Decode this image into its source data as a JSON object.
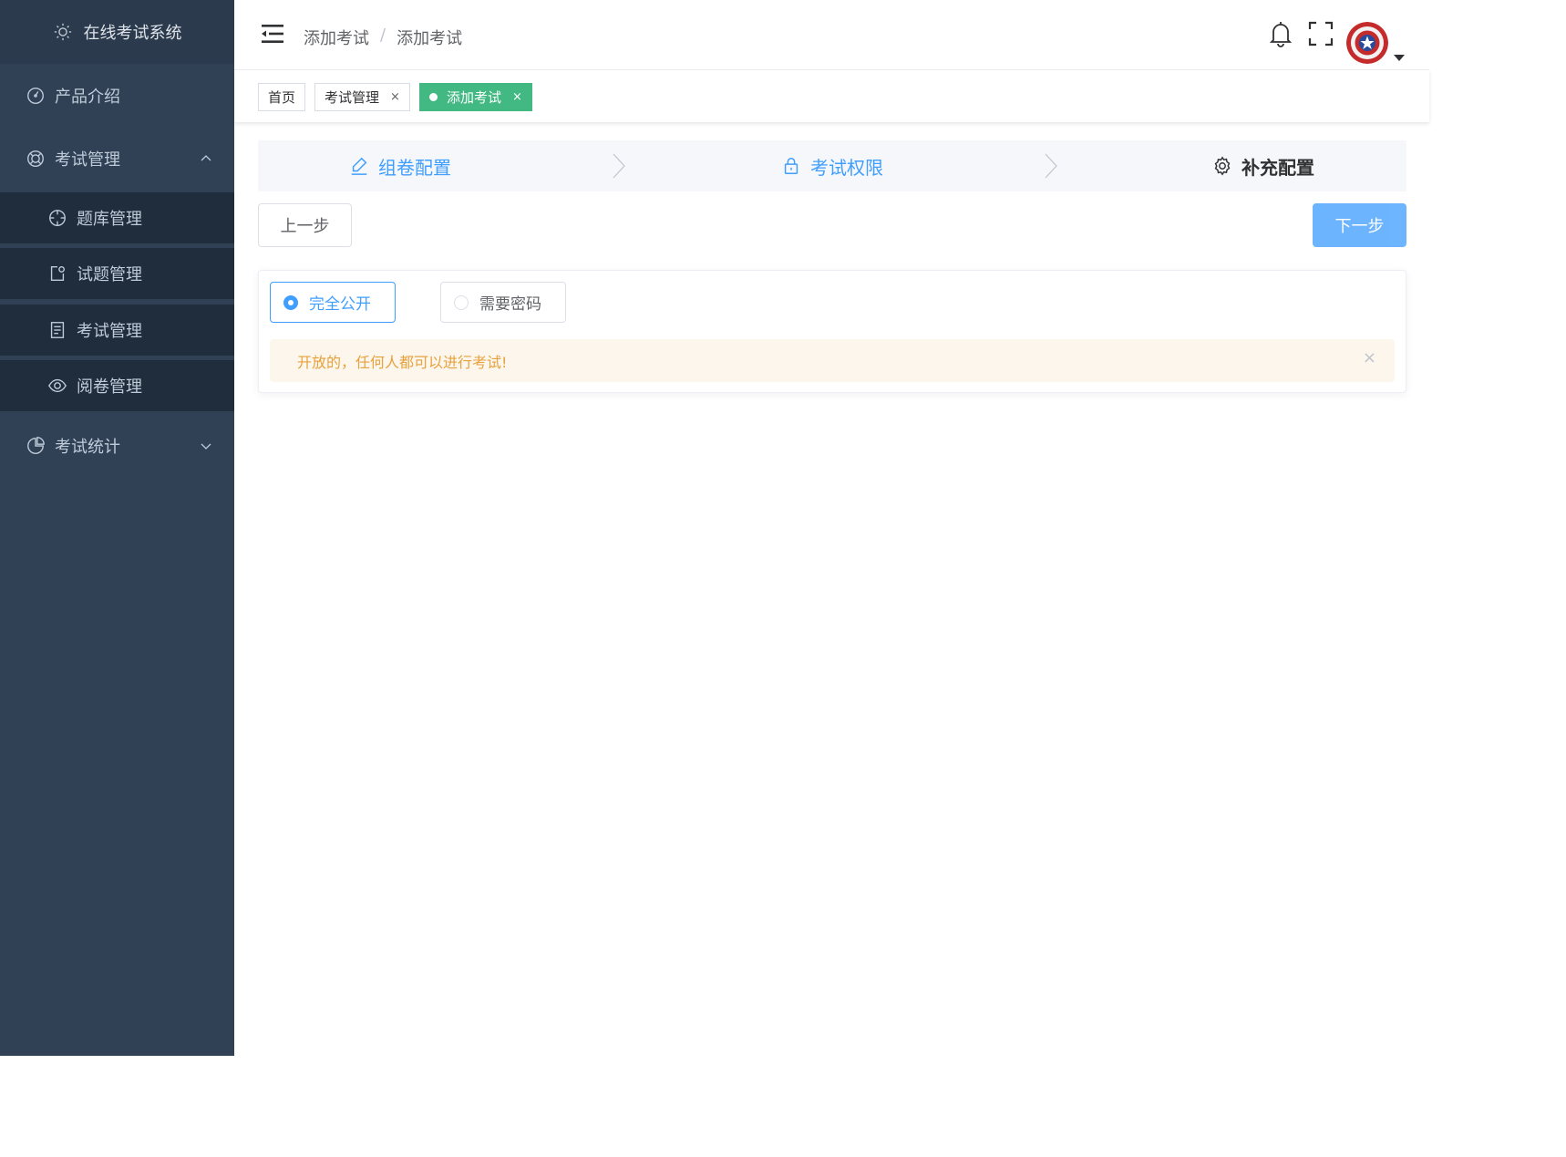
{
  "sidebar": {
    "app_title": "在线考试系统",
    "items": [
      {
        "label": "产品介绍",
        "icon": "dashboard-icon"
      },
      {
        "label": "考试管理",
        "icon": "lifebuoy-icon",
        "expanded": true
      },
      {
        "label": "题库管理",
        "icon": "crosshair-icon"
      },
      {
        "label": "试题管理",
        "icon": "edit-doc-icon"
      },
      {
        "label": "考试管理",
        "icon": "document-icon"
      },
      {
        "label": "阅卷管理",
        "icon": "eye-icon"
      },
      {
        "label": "考试统计",
        "icon": "pie-chart-icon",
        "expanded": false
      }
    ]
  },
  "header": {
    "breadcrumb": [
      "添加考试",
      "/",
      "添加考试"
    ]
  },
  "tags": [
    {
      "label": "首页"
    },
    {
      "label": "考试管理",
      "close": "×"
    },
    {
      "label": "添加考试",
      "close": "×",
      "active": true
    }
  ],
  "steps": [
    {
      "label": "组卷配置",
      "icon": "pencil-icon",
      "status": "done"
    },
    {
      "label": "考试权限",
      "icon": "lock-icon",
      "status": "done"
    },
    {
      "label": "补充配置",
      "icon": "gear-icon",
      "status": "current"
    }
  ],
  "buttons": {
    "prev": "上一步",
    "next": "下一步"
  },
  "permission": {
    "options": [
      "完全公开",
      "需要密码"
    ],
    "selected": "完全公开",
    "alert_text": "开放的，任何人都可以进行考试!",
    "alert_close": "×"
  },
  "colors": {
    "sidebar_bg": "#304156",
    "primary": "#409eff",
    "tag_active": "#42b983",
    "warning": "#e6a23c"
  }
}
